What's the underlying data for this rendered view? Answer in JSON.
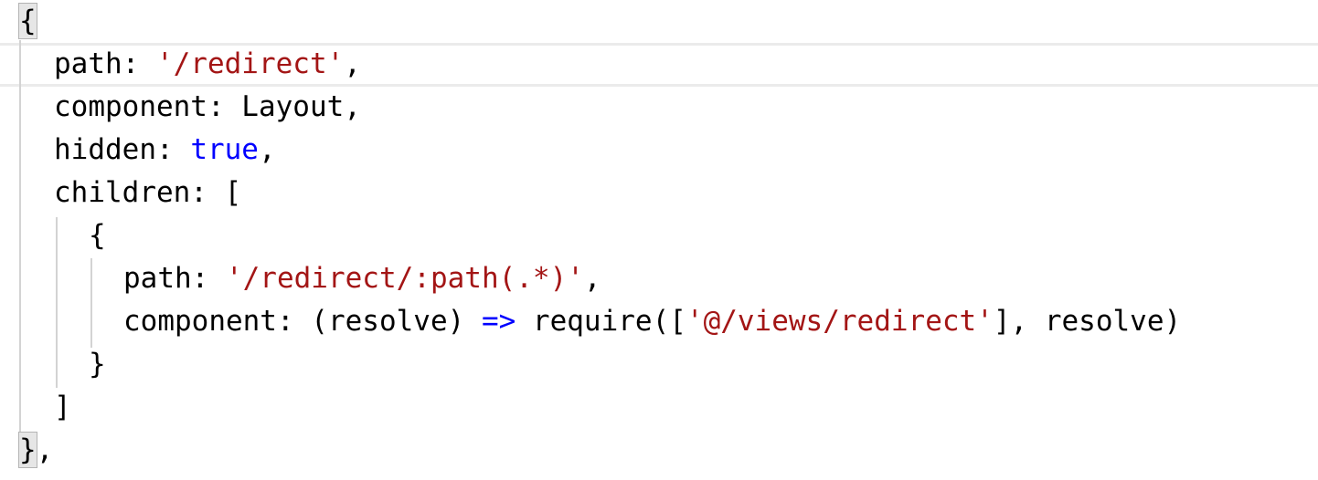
{
  "editor": {
    "lines": [
      {
        "indent": "",
        "tokens": [
          {
            "t": "{",
            "c": "brace"
          }
        ]
      },
      {
        "indent": "  ",
        "tokens": [
          {
            "t": "path: ",
            "c": "plain"
          },
          {
            "t": "'/redirect'",
            "c": "str"
          },
          {
            "t": ",",
            "c": "plain"
          }
        ]
      },
      {
        "indent": "  ",
        "tokens": [
          {
            "t": "component: Layout,",
            "c": "plain"
          }
        ]
      },
      {
        "indent": "  ",
        "tokens": [
          {
            "t": "hidden: ",
            "c": "plain"
          },
          {
            "t": "true",
            "c": "kw"
          },
          {
            "t": ",",
            "c": "plain"
          }
        ]
      },
      {
        "indent": "  ",
        "tokens": [
          {
            "t": "children: [",
            "c": "plain"
          }
        ]
      },
      {
        "indent": "    ",
        "tokens": [
          {
            "t": "{",
            "c": "plain"
          }
        ]
      },
      {
        "indent": "      ",
        "tokens": [
          {
            "t": "path: ",
            "c": "plain"
          },
          {
            "t": "'/redirect/:path(.*)'",
            "c": "str"
          },
          {
            "t": ",",
            "c": "plain"
          }
        ]
      },
      {
        "indent": "      ",
        "tokens": [
          {
            "t": "component: (resolve) ",
            "c": "plain"
          },
          {
            "t": "=>",
            "c": "op"
          },
          {
            "t": " require([",
            "c": "plain"
          },
          {
            "t": "'@/views/redirect'",
            "c": "str"
          },
          {
            "t": "], resolve)",
            "c": "plain"
          }
        ]
      },
      {
        "indent": "    ",
        "tokens": [
          {
            "t": "}",
            "c": "plain"
          }
        ]
      },
      {
        "indent": "  ",
        "tokens": [
          {
            "t": "]",
            "c": "plain"
          }
        ]
      },
      {
        "indent": "",
        "tokens": [
          {
            "t": "}",
            "c": "brace"
          },
          {
            "t": ",",
            "c": "plain"
          }
        ]
      }
    ]
  },
  "colors": {
    "string": "#a31515",
    "keyword": "#0000ff",
    "text": "#000000",
    "current_line_border": "#ebebeb",
    "indent_guide": "#d3d3d3",
    "brace_match_bg": "#e6e6e6"
  }
}
